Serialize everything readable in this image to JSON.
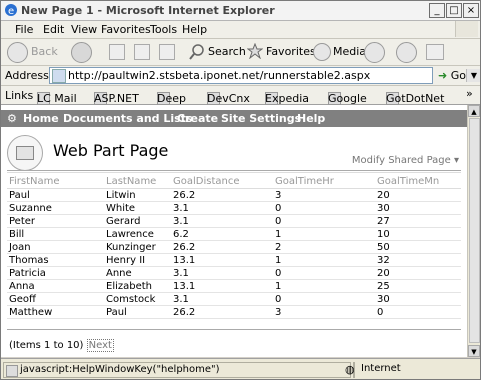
{
  "window": {
    "title": "New Page 1 - Microsoft Internet Explorer"
  },
  "menu": [
    "File",
    "Edit",
    "View",
    "Favorites",
    "Tools",
    "Help"
  ],
  "toolbar": {
    "back": "Back",
    "search": "Search",
    "favorites": "Favorites",
    "media": "Media"
  },
  "address": {
    "label": "Address",
    "url": "http://paultwin2.stsbeta.iponet.net/runnerstable2.aspx",
    "go": "Go"
  },
  "links": {
    "label": "Links",
    "items": [
      "LC Mail",
      "ASP.NET",
      "Deep",
      "DevCnx",
      "Expedia",
      "Google",
      "GotDotNet"
    ]
  },
  "nav": [
    "Home",
    "Documents and Lists",
    "Create",
    "Site Settings",
    "Help"
  ],
  "page": {
    "title": "Web Part Page",
    "modify": "Modify Shared Page"
  },
  "table": {
    "headers": [
      "FirstName",
      "LastName",
      "GoalDistance",
      "GoalTimeHr",
      "GoalTimeMn"
    ],
    "rows": [
      [
        "Paul",
        "Litwin",
        "26.2",
        "3",
        "20"
      ],
      [
        "Suzanne",
        "White",
        "3.1",
        "0",
        "30"
      ],
      [
        "Peter",
        "Gerard",
        "3.1",
        "0",
        "27"
      ],
      [
        "Bill",
        "Lawrence",
        "6.2",
        "1",
        "10"
      ],
      [
        "Joan",
        "Kunzinger",
        "26.2",
        "2",
        "50"
      ],
      [
        "Thomas",
        "Henry II",
        "13.1",
        "1",
        "32"
      ],
      [
        "Patricia",
        "Anne",
        "3.1",
        "0",
        "20"
      ],
      [
        "Anna",
        "Elizabeth",
        "13.1",
        "1",
        "25"
      ],
      [
        "Geoff",
        "Comstock",
        "3.1",
        "0",
        "30"
      ],
      [
        "Matthew",
        "Paul",
        "26.2",
        "3",
        "0"
      ]
    ]
  },
  "pager": {
    "text": "(Items 1 to 10)",
    "next": "Next"
  },
  "status": {
    "text": "javascript:HelpWindowKey(\"helphome\")",
    "zone": "Internet"
  }
}
